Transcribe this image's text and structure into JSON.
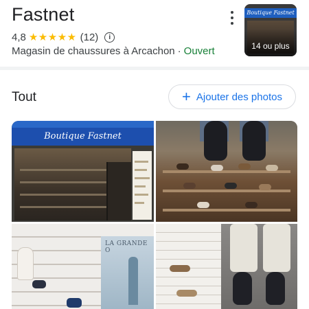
{
  "place": {
    "name": "Fastnet",
    "rating": "4,8",
    "stars": "★★★★★",
    "review_count": "(12)",
    "info_icon": "i",
    "category": "Magasin de chaussures à Arcachon",
    "separator": "·",
    "status": "Ouvert"
  },
  "header_thumb": {
    "photo_count_label": "14 ou plus",
    "sign_text": "Boutique Fastnet"
  },
  "photos_section": {
    "title": "Tout",
    "add_button_icon": "+",
    "add_button_label": "Ajouter des photos"
  },
  "photos": [
    {
      "sign_text": "Boutique Fastnet"
    },
    {},
    {
      "poster_text": "LA GRANDE O"
    },
    {}
  ],
  "colors": {
    "accent": "#1a73e8",
    "star": "#fbbc04",
    "open_status": "#188038",
    "sign_blue": "#1d4fae"
  },
  "icons": [
    "more-vert-icon",
    "info-icon",
    "plus-icon",
    "star-icon"
  ]
}
